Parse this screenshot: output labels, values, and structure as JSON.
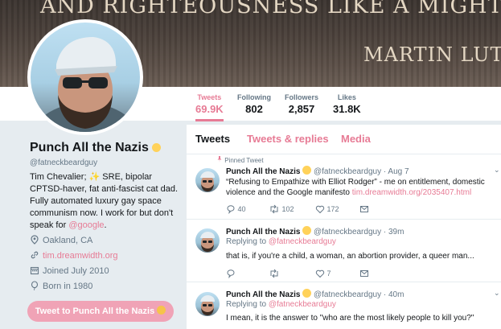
{
  "banner": {
    "line1": "AND RIGHTEOUSNESS LIKE A MIGHTY ST",
    "line2": "MARTIN LUT"
  },
  "stats": [
    {
      "label": "Tweets",
      "value": "69.9K"
    },
    {
      "label": "Following",
      "value": "802"
    },
    {
      "label": "Followers",
      "value": "2,857"
    },
    {
      "label": "Likes",
      "value": "31.8K"
    }
  ],
  "profile": {
    "name": "Punch All the Nazis",
    "handle": "@fatneckbeardguy",
    "bio_main": "Tim Chevalier; ✨ SRE, bipolar CPTSD-haver, fat anti-fascist cat dad. Fully automated luxury gay space communism now. I work for but don't speak for",
    "bio_link": "@google",
    "bio_end": ".",
    "location": "Oakland, CA",
    "website": "tim.dreamwidth.org",
    "joined": "Joined July 2010",
    "born": "Born in 1980",
    "tweet_to_button": "Tweet to Punch All the Nazis"
  },
  "tabs": [
    "Tweets",
    "Tweets & replies",
    "Media"
  ],
  "tweets": [
    {
      "pinned": "Pinned Tweet",
      "name": "Punch All the Nazis",
      "handle_time": "@fatneckbeardguy · Aug 7",
      "text": "“Refusing to Empathize with Elliot Rodger” - me on entitlement, domestic violence and the Google manifesto",
      "link": "tim.dreamwidth.org/2035407.html",
      "replies": "40",
      "retweets": "102",
      "likes": "172"
    },
    {
      "name": "Punch All the Nazis",
      "handle_time": "@fatneckbeardguy · 39m",
      "replying_label": "Replying to",
      "replying_to": "@fatneckbeardguy",
      "text": "that is, if you're a child, a woman, an abortion provider, a queer man...",
      "replies": "",
      "retweets": "",
      "likes": "7"
    },
    {
      "name": "Punch All the Nazis",
      "handle_time": "@fatneckbeardguy · 40m",
      "replying_label": "Replying to",
      "replying_to": "@fatneckbeardguy",
      "text": "I mean, it is the answer to \"who are the most likely people to kill you?\""
    }
  ],
  "colors": {
    "accent": "#e77b95",
    "button": "#f0a3b6",
    "muted": "#657786"
  }
}
